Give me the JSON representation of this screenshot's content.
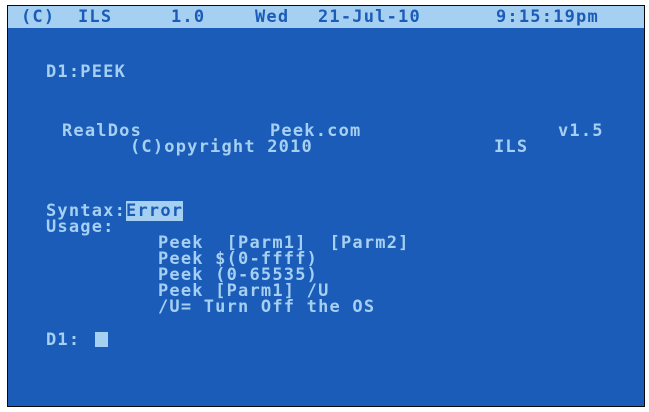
{
  "status_bar": {
    "copyright": "(C)",
    "app": "ILS",
    "version": "1.0",
    "weekday": "Wed",
    "date": "21-Jul-10",
    "time": "9:15:19pm"
  },
  "command": "D1:PEEK",
  "banner": {
    "name": "RealDos",
    "program": "Peek.com",
    "version": "v1.5",
    "copyright": "(C)opyright 2010",
    "author": "ILS"
  },
  "syntax": {
    "label": "Syntax:",
    "status": "Error"
  },
  "usage": {
    "label": "Usage:",
    "lines": [
      "Peek  [Parm1]  [Parm2]",
      "Peek $(0-ffff)",
      "Peek (0-65535)",
      "Peek [Parm1] /U",
      "/U= Turn Off the OS"
    ]
  },
  "prompt": "D1:",
  "colors": {
    "screen": "#1b5cb8",
    "text": "#a6d0f2"
  }
}
